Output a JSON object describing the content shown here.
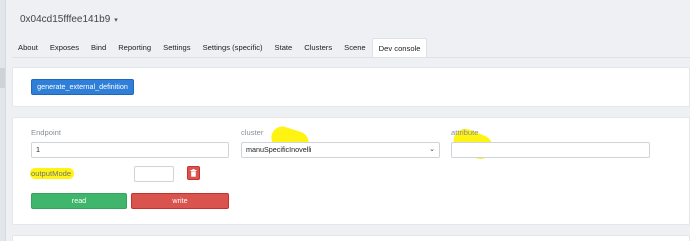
{
  "device": {
    "name": "0x04cd15fffee141b9",
    "dropdown_icon": "chevron-down-icon"
  },
  "tabs": [
    {
      "label": "About",
      "active": false
    },
    {
      "label": "Exposes",
      "active": false
    },
    {
      "label": "Bind",
      "active": false
    },
    {
      "label": "Reporting",
      "active": false
    },
    {
      "label": "Settings",
      "active": false
    },
    {
      "label": "Settings (specific)",
      "active": false
    },
    {
      "label": "State",
      "active": false
    },
    {
      "label": "Clusters",
      "active": false
    },
    {
      "label": "Scene",
      "active": false
    },
    {
      "label": "Dev console",
      "active": true
    }
  ],
  "generate_button": {
    "label": "generate_external_definition"
  },
  "form": {
    "endpoint": {
      "label": "Endpoint",
      "value": "1"
    },
    "cluster": {
      "label": "cluster",
      "value": "manuSpecificInovelli"
    },
    "attribute": {
      "label": "attribute",
      "value": ""
    },
    "output_mode": {
      "label": "outputMode",
      "value": ""
    },
    "delete_icon": "trash-icon"
  },
  "actions": {
    "read_label": "read",
    "write_label": "write"
  },
  "colors": {
    "primary": "#2f7fd8",
    "success": "#3fb66b",
    "danger": "#d9534f",
    "highlight": "#fff200"
  }
}
